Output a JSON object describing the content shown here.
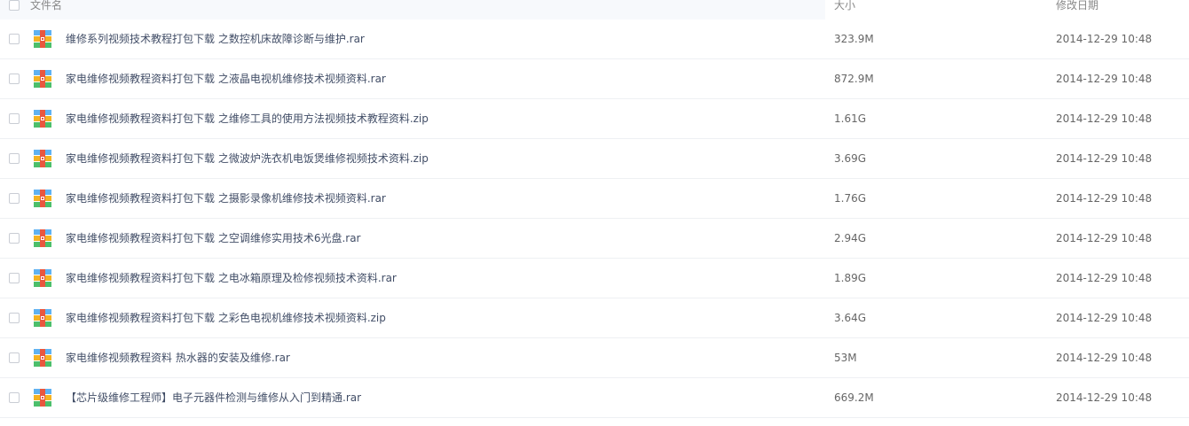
{
  "header": {
    "name_label": "文件名",
    "size_label": "大小",
    "date_label": "修改日期"
  },
  "files": [
    {
      "name": "维修系列视频技术教程打包下载 之数控机床故障诊断与维护.rar",
      "size": "323.9M",
      "modified": "2014-12-29 10:48",
      "icon": "archive-icon"
    },
    {
      "name": "家电维修视频教程资料打包下载 之液晶电视机维修技术视频资料.rar",
      "size": "872.9M",
      "modified": "2014-12-29 10:48",
      "icon": "archive-icon"
    },
    {
      "name": "家电维修视频教程资料打包下载 之维修工具的使用方法视频技术教程资料.zip",
      "size": "1.61G",
      "modified": "2014-12-29 10:48",
      "icon": "archive-icon"
    },
    {
      "name": "家电维修视频教程资料打包下载 之微波炉洗衣机电饭煲维修视频技术资料.zip",
      "size": "3.69G",
      "modified": "2014-12-29 10:48",
      "icon": "archive-icon"
    },
    {
      "name": "家电维修视频教程资料打包下载 之摄影录像机维修技术视频资料.rar",
      "size": "1.76G",
      "modified": "2014-12-29 10:48",
      "icon": "archive-icon"
    },
    {
      "name": "家电维修视频教程资料打包下载 之空调维修实用技术6光盘.rar",
      "size": "2.94G",
      "modified": "2014-12-29 10:48",
      "icon": "archive-icon"
    },
    {
      "name": "家电维修视频教程资料打包下载 之电冰箱原理及检修视频技术资料.rar",
      "size": "1.89G",
      "modified": "2014-12-29 10:48",
      "icon": "archive-icon"
    },
    {
      "name": "家电维修视频教程资料打包下载 之彩色电视机维修技术视频资料.zip",
      "size": "3.64G",
      "modified": "2014-12-29 10:48",
      "icon": "archive-icon"
    },
    {
      "name": "家电维修视频教程资料 热水器的安装及维修.rar",
      "size": "53M",
      "modified": "2014-12-29 10:48",
      "icon": "archive-icon"
    },
    {
      "name": "【芯片级维修工程师】电子元器件检测与维修从入门到精通.rar",
      "size": "669.2M",
      "modified": "2014-12-29 10:48",
      "icon": "archive-icon"
    }
  ]
}
